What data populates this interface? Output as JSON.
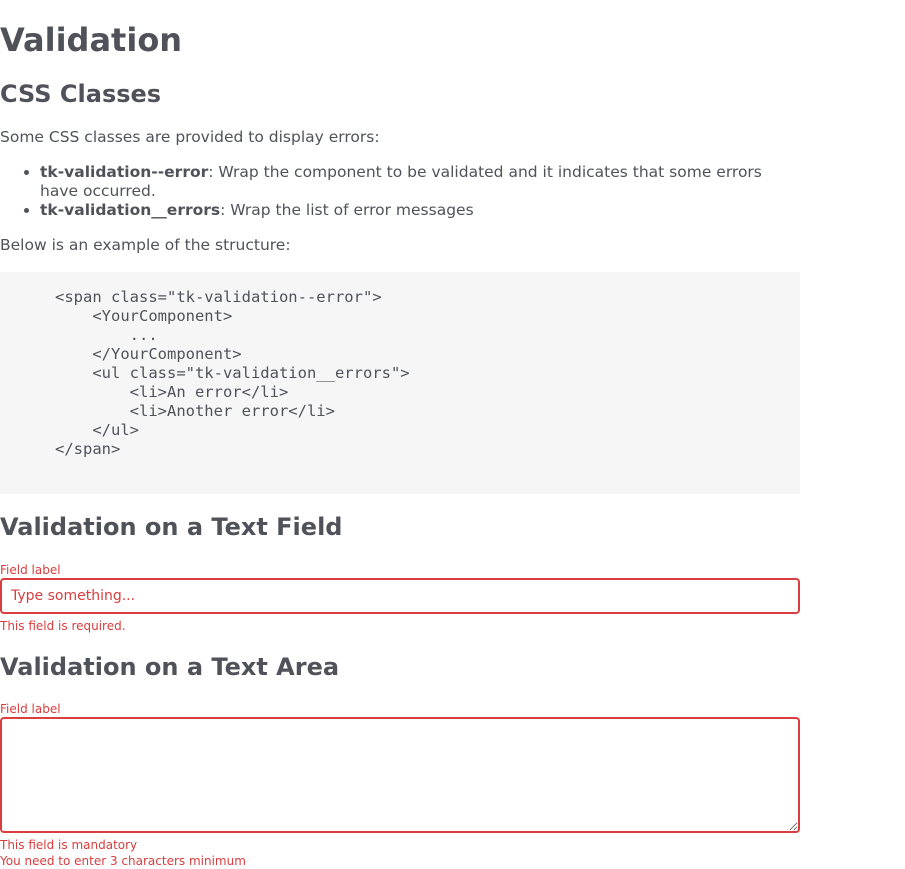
{
  "page": {
    "title": "Validation"
  },
  "css_section": {
    "heading": "CSS Classes",
    "intro": "Some CSS classes are provided to display errors:",
    "items": [
      {
        "term": "tk-validation--error",
        "desc": ": Wrap the component to be validated and it indicates that some errors have occurred."
      },
      {
        "term": "tk-validation__errors",
        "desc": ": Wrap the list of error messages"
      }
    ],
    "structure_intro": "Below is an example of the structure:",
    "code": "<span class=\"tk-validation--error\">\n    <YourComponent>\n        ...\n    </YourComponent>\n    <ul class=\"tk-validation__errors\">\n        <li>An error</li>\n        <li>Another error</li>\n    </ul>\n</span>"
  },
  "text_field_section": {
    "heading": "Validation on a Text Field",
    "label": "Field label",
    "placeholder": "Type something...",
    "value": "",
    "errors": [
      "This field is required."
    ]
  },
  "text_area_section": {
    "heading": "Validation on a Text Area",
    "label": "Field label",
    "value": "",
    "errors": [
      "This field is mandatory",
      "You need to enter 3 characters minimum"
    ]
  },
  "colors": {
    "text": "#4f5359",
    "error": "#d93d3d",
    "code_background": "#f6f6f6"
  }
}
